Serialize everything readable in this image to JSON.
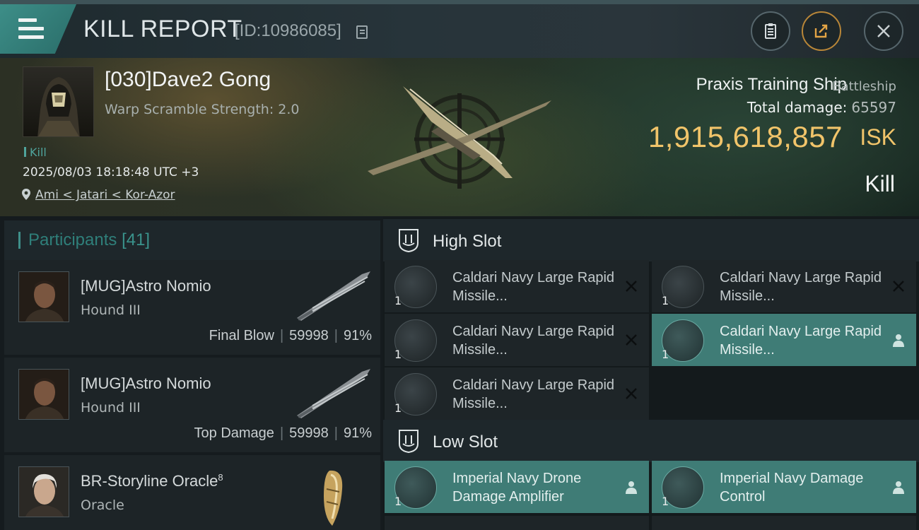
{
  "header": {
    "title": "KILL REPORT",
    "report_id": "[ID:10986085]"
  },
  "victim": {
    "name": "[030]Dave2 Gong",
    "warp_scramble": "Warp Scramble Strength: 2.0",
    "tag": "Kill",
    "datetime": "2025/08/03 18:18:48 UTC +3",
    "location": "Ami < Jatari < Kor-Azor",
    "ship_name": "Praxis Training Ship",
    "ship_class": "Battleship",
    "total_damage_label": "Total damage:",
    "total_damage_value": "65597",
    "isk_value": "1,915,618,857",
    "isk_unit": "ISK",
    "result": "Kill"
  },
  "participants": {
    "title": "Participants",
    "count": "[41]",
    "rows": [
      {
        "name": "[MUG]Astro Nomio",
        "ship": "Hound III",
        "role": "Final Blow",
        "damage": "59998",
        "percent": "91%"
      },
      {
        "name": "[MUG]Astro Nomio",
        "ship": "Hound III",
        "role": "Top Damage",
        "damage": "59998",
        "percent": "91%"
      },
      {
        "name": "BR-Storyline Oracle",
        "name_sup": "8",
        "ship": "Oracle"
      }
    ]
  },
  "slots": {
    "high": {
      "title": "High Slot",
      "modules": [
        {
          "name": "Caldari Navy Large Rapid Missile...",
          "qty": "1",
          "status": "destroyed"
        },
        {
          "name": "Caldari Navy Large Rapid Missile...",
          "qty": "1",
          "status": "destroyed"
        },
        {
          "name": "Caldari Navy Large Rapid Missile...",
          "qty": "1",
          "status": "destroyed"
        },
        {
          "name": "Caldari Navy Large Rapid Missile...",
          "qty": "1",
          "status": "dropped"
        },
        {
          "name": "Caldari Navy Large Rapid Missile...",
          "qty": "1",
          "status": "destroyed"
        }
      ]
    },
    "low": {
      "title": "Low Slot",
      "modules": [
        {
          "name": "Imperial Navy Drone Damage Amplifier",
          "qty": "1",
          "status": "dropped"
        },
        {
          "name": "Imperial Navy Damage Control",
          "qty": "1",
          "status": "dropped"
        }
      ]
    }
  },
  "colors": {
    "accent_teal": "#3f7c76",
    "isk_gold": "#f1c46a",
    "header_menu": "#3d8e88"
  },
  "icons": [
    "menu-icon",
    "copy-icon",
    "clipboard-icon",
    "share-icon",
    "close-icon",
    "location-pin-icon",
    "slot-icon",
    "destroyed-x-icon",
    "dropped-person-icon"
  ]
}
